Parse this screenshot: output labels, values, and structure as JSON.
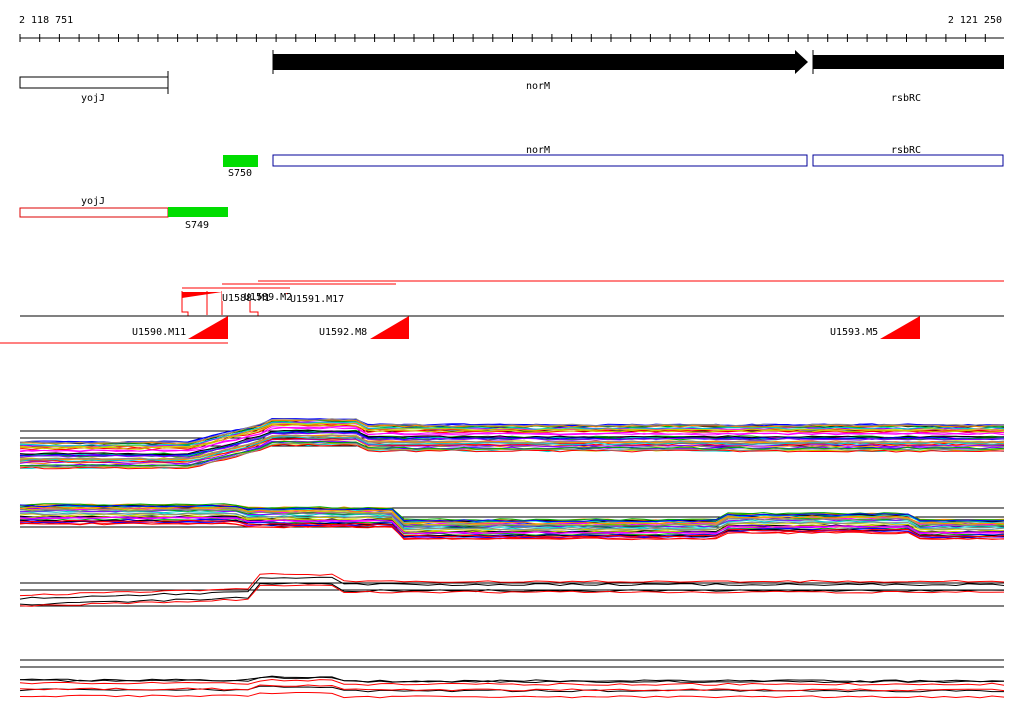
{
  "ruler": {
    "start_label": "2 118 751",
    "end_label": "2 121 250"
  },
  "annotation_track": {
    "genes": [
      {
        "name": "yojJ",
        "style": "outline"
      },
      {
        "name": "norM",
        "style": "arrow"
      },
      {
        "name": "rsbRC",
        "style": "filled"
      }
    ]
  },
  "sequence_track": {
    "segments": [
      {
        "label": "S750",
        "color": "#00dd00"
      },
      {
        "label": "norM",
        "color": "#000099"
      },
      {
        "label": "rsbRC",
        "color": "#000099"
      }
    ]
  },
  "reverse_track": {
    "segments": [
      {
        "label": "yojJ",
        "color": "#dd0000"
      },
      {
        "label": "S749",
        "color": "#00dd00"
      }
    ]
  },
  "transcripts": {
    "upper_labels": [
      "U1591.M17",
      "U1589.M2",
      "U1588.M1"
    ],
    "lower_labels": [
      "U1590.M11",
      "U1592.M8",
      "U1593.M5"
    ],
    "mark_color": "#ff0000"
  },
  "profiles": {
    "panel_count": 4,
    "colors": [
      "#000000",
      "#ff0000",
      "#00aa00",
      "#0000ff",
      "#ff00ff",
      "#00cccc",
      "#cccc00",
      "#ff8800",
      "#8800ff",
      "#888888"
    ]
  }
}
